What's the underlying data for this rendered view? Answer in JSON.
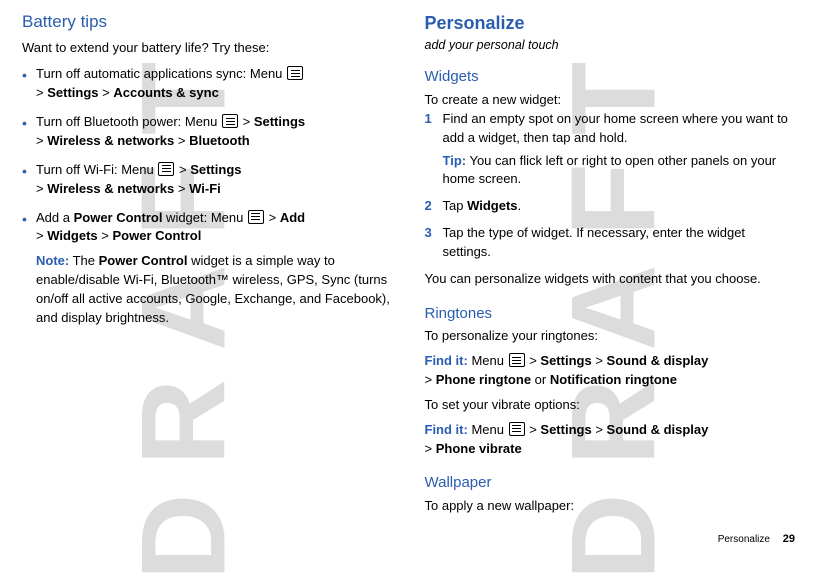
{
  "watermark": "DRAFT",
  "left": {
    "heading": "Battery tips",
    "intro": "Want to extend your battery life? Try these:",
    "bullets": [
      {
        "pre": "Turn off automatic applications sync: Menu ",
        "path": " > ",
        "p1": "Settings",
        "gt": " > ",
        "p2": "Accounts & sync"
      },
      {
        "pre": "Turn off Bluetooth power: Menu ",
        "path": " > ",
        "p1": "Settings",
        "gt1": " > ",
        "p2": "Wireless & networks",
        "gt2": " > ",
        "p3": "Bluetooth"
      },
      {
        "pre": "Turn off Wi-Fi: Menu ",
        "path": " > ",
        "p1": "Settings",
        "gt1": " > ",
        "p2": "Wireless & networks",
        "gt2": " > ",
        "p3": "Wi-Fi"
      },
      {
        "pre": "Add a ",
        "b1": "Power Control",
        "mid": " widget: Menu ",
        "path": " > ",
        "p1": "Add",
        "gt1": " > ",
        "p2": "Widgets",
        "gt2": " > ",
        "p3": "Power Control"
      }
    ],
    "note_label": "Note:",
    "note_a": " The ",
    "note_b": "Power Control",
    "note_c": " widget is a simple way to enable/disable Wi-Fi, Bluetooth™ wireless, GPS, Sync (turns on/off all active accounts, Google, Exchange, and Facebook), and display brightness."
  },
  "right": {
    "heading": "Personalize",
    "subtitle": "add your personal touch",
    "widgets_h": "Widgets",
    "widgets_intro": "To create a new widget:",
    "step1": "Find an empty spot on your home screen where you want to add a widget, then tap and hold.",
    "tip_label": "Tip:",
    "tip_text": " You can flick left or right to open other panels on your home screen.",
    "step2a": "Tap ",
    "step2b": "Widgets",
    "step2c": ".",
    "step3": "Tap the type of widget. If necessary, enter the widget settings.",
    "widgets_outro": "You can personalize widgets with content that you choose.",
    "ring_h": "Ringtones",
    "ring_intro": "To personalize your ringtones:",
    "find_label": "Find it:",
    "ring_path_a": " Menu ",
    "ring_p1": "Settings",
    "ring_p2": "Sound & display",
    "ring_p3": "Phone ringtone",
    "ring_or": " or ",
    "ring_p4": "Notification ringtone",
    "vib_intro": "To set your vibrate options:",
    "vib_p1": "Settings",
    "vib_p2": "Sound & display",
    "vib_p3": "Phone vibrate",
    "wall_h": "Wallpaper",
    "wall_intro": "To apply a new wallpaper:"
  },
  "gt": " > ",
  "footer_text": "Personalize",
  "footer_page": "29"
}
